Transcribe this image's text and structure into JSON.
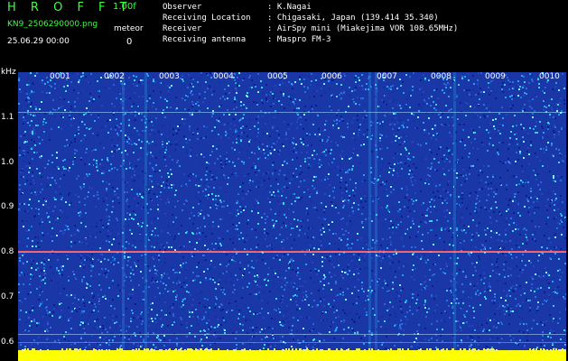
{
  "header": {
    "app_title": "H R O F F T",
    "version": "1.00f",
    "filename": "KN9_2506290000.png",
    "meteor_label": "meteor",
    "datetime": "25.06.29 00:00",
    "meteor_count": "0"
  },
  "metadata": [
    {
      "key": "Observer",
      "value": ": K.Nagai"
    },
    {
      "key": "Receiving Location",
      "value": ": Chigasaki, Japan (139.414 35.340)"
    },
    {
      "key": "Receiver",
      "value": ": AirSpy mini (Miakejima VOR 108.65MHz)"
    },
    {
      "key": "Receiving antenna",
      "value": ": Maspro FM-3"
    }
  ],
  "axis": {
    "y_unit": "kHz",
    "y_ticks": [
      "1.1",
      "1.0",
      "0.9",
      "0.8",
      "0.7",
      "0.6"
    ],
    "x_ticks": [
      "0001",
      "0002",
      "0003",
      "0004",
      "0005",
      "0006",
      "0007",
      "0008",
      "0009",
      "0010"
    ]
  },
  "colors": {
    "text_green": "#3cff3c",
    "background": "#000000",
    "spectrogram_base": "#1a37a8",
    "noise_floor": "#ffff00",
    "signal_line": "#ff6060"
  }
}
